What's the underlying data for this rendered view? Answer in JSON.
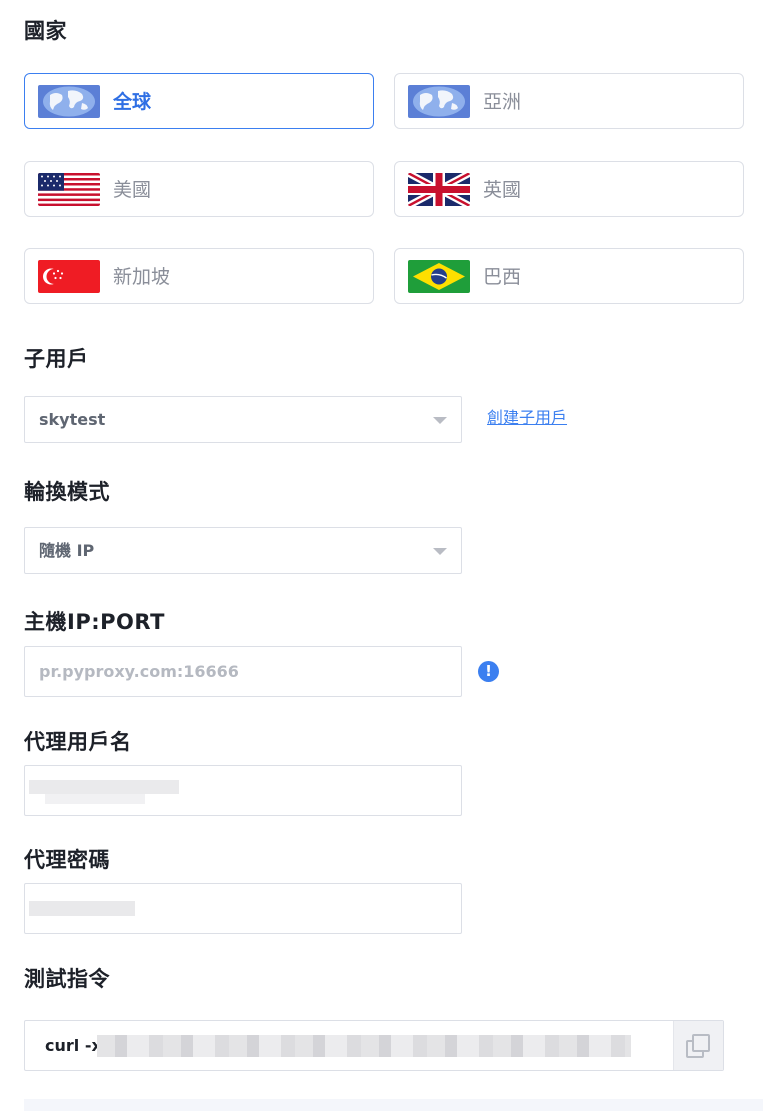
{
  "country": {
    "title": "國家",
    "options": [
      {
        "label": "全球",
        "icon": "globe-icon",
        "selected": true
      },
      {
        "label": "亞洲",
        "icon": "globe-icon",
        "selected": false
      },
      {
        "label": "美國",
        "icon": "us-flag-icon",
        "selected": false
      },
      {
        "label": "英國",
        "icon": "uk-flag-icon",
        "selected": false
      },
      {
        "label": "新加坡",
        "icon": "singapore-flag-icon",
        "selected": false
      },
      {
        "label": "巴西",
        "icon": "brazil-flag-icon",
        "selected": false
      }
    ]
  },
  "subuser": {
    "title": "子用戶",
    "value": "skytest",
    "create_link": "創建子用戶"
  },
  "rotation": {
    "title": "輪換模式",
    "value": "隨機 IP"
  },
  "host": {
    "title": "主機IP:PORT",
    "placeholder": "pr.pyproxy.com:16666",
    "info_icon": "!"
  },
  "proxy_user": {
    "title": "代理用戶名"
  },
  "proxy_password": {
    "title": "代理密碼"
  },
  "test_command": {
    "title": "測試指令",
    "prefix": "curl -x"
  },
  "colors": {
    "accent": "#3b7ff0",
    "border": "#dcdfe6",
    "muted_text": "#8a8e99"
  }
}
